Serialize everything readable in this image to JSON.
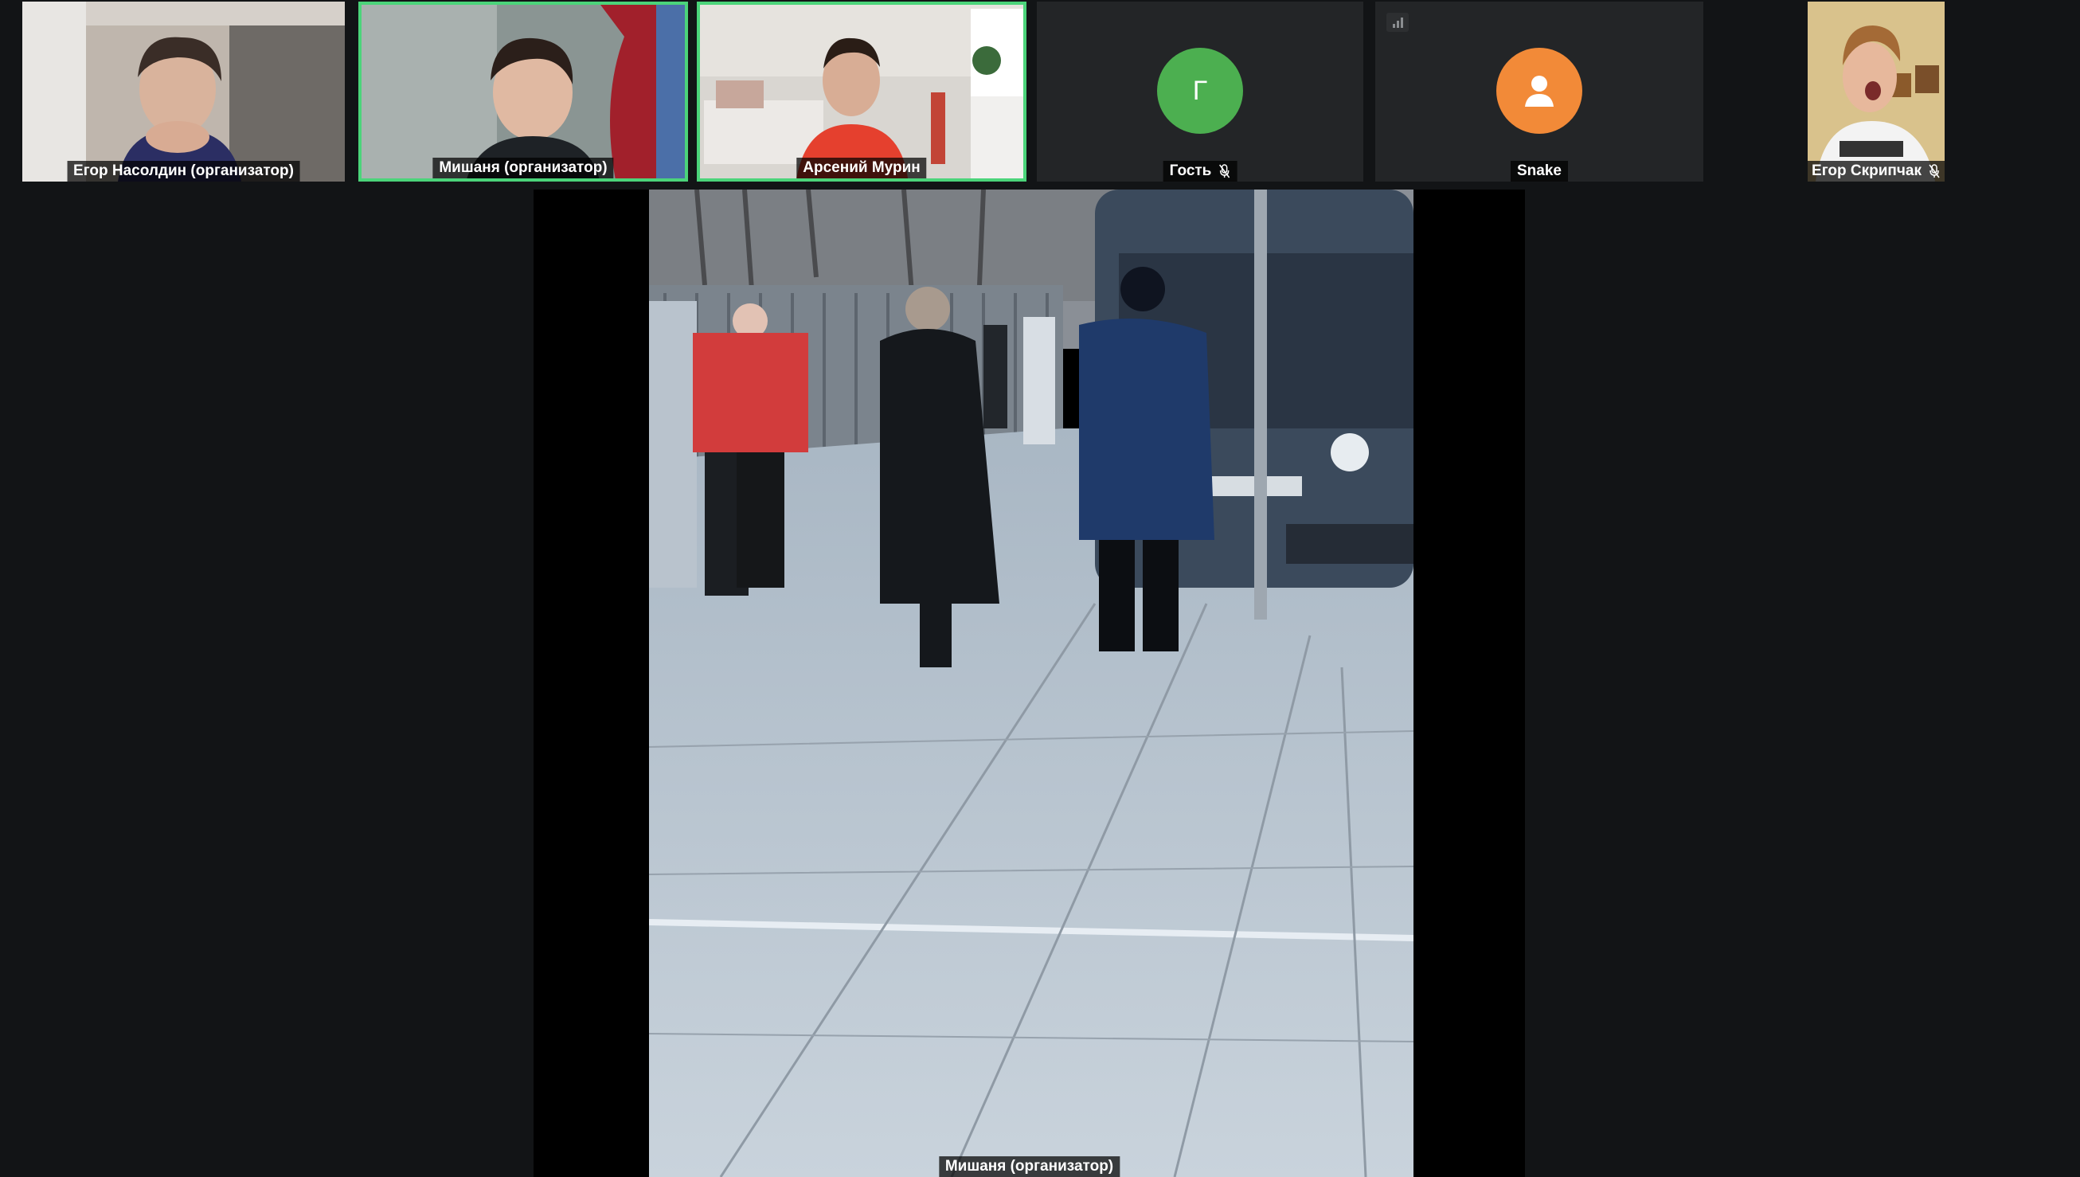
{
  "participants": [
    {
      "name": "Егор Насолдин (организатор)",
      "type": "video",
      "active": false
    },
    {
      "name": "Мишаня (организатор)",
      "type": "video",
      "active": true
    },
    {
      "name": "Арсений Мурин",
      "type": "video",
      "active": true
    },
    {
      "name": "Гость",
      "type": "avatar",
      "initial": "Г",
      "avatar_color": "#4caf50",
      "muted": true
    },
    {
      "name": "Snake",
      "type": "avatar",
      "initial": "",
      "avatar_color": "#f28a38",
      "muted": false
    },
    {
      "name": "Егор Скрипчак",
      "type": "video",
      "muted": true
    }
  ],
  "main_stage": {
    "speaker_label": "Мишаня (организатор)"
  },
  "icons": {
    "mic_off": "mic-off-icon",
    "user": "user-icon",
    "signal": "signal-icon"
  },
  "colors": {
    "background": "#121416",
    "tile": "#232527",
    "active_border": "#4bd47a"
  }
}
